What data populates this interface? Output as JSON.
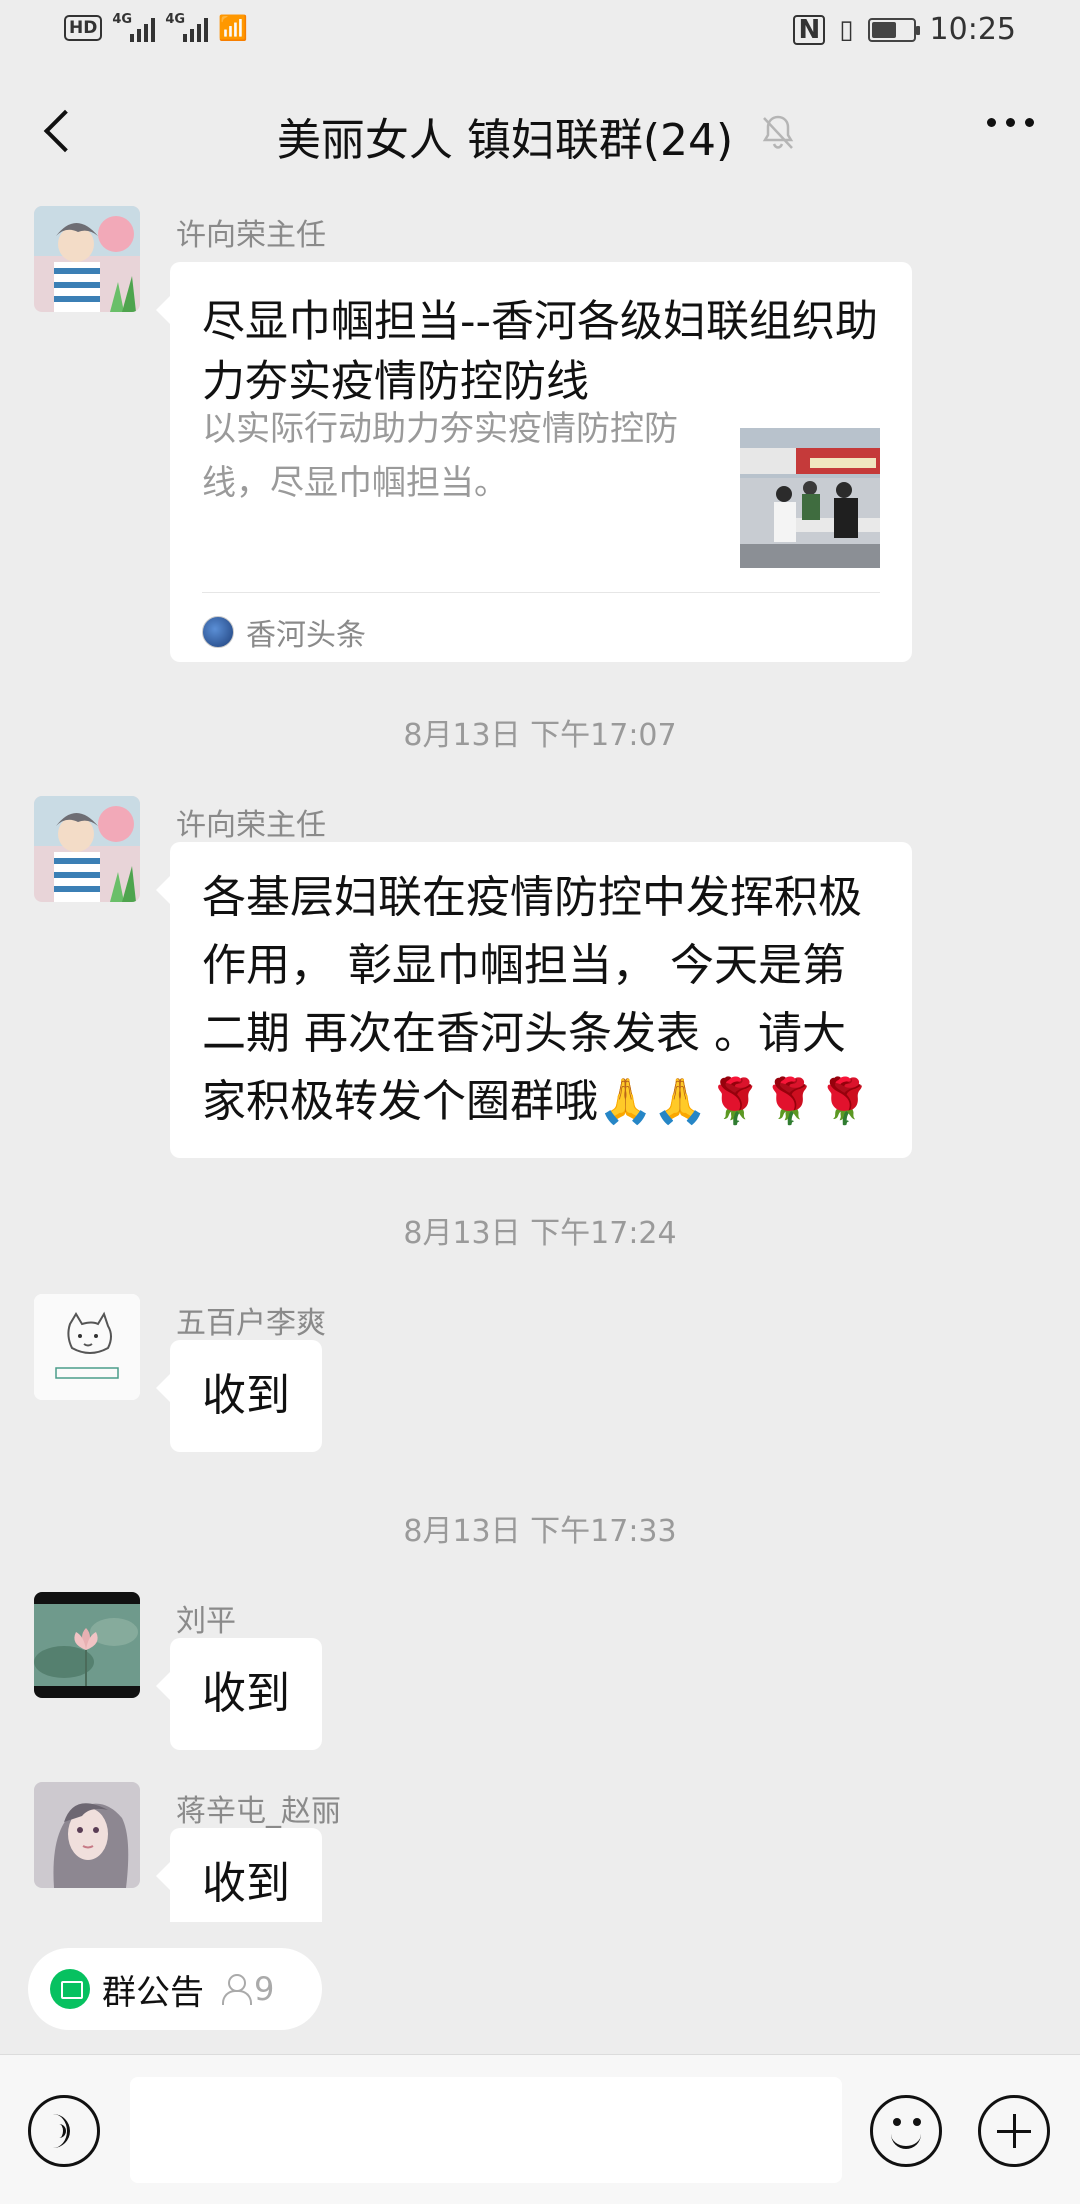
{
  "status_bar": {
    "hd": "HD",
    "network_1": "4G",
    "network_2": "4G",
    "time": "10:25",
    "battery_level": 0.6
  },
  "header": {
    "title": "美丽女人 镇妇联群(24)",
    "back_icon": "chevron-left-icon",
    "mute_icon": "bell-off-icon",
    "more_icon": "more-dots-icon"
  },
  "messages": [
    {
      "type": "link_card",
      "sender": "许向荣主任",
      "card_title": "尽显巾帼担当--香河各级妇联组织助力夯实疫情防控防线",
      "card_desc": "以实际行动助力夯实疫情防控防线，尽显巾帼担当。",
      "card_source": "香河头条"
    },
    {
      "type": "time",
      "text": "8月13日 下午17:07"
    },
    {
      "type": "text",
      "sender": "许向荣主任",
      "text": "各基层妇联在疫情防控中发挥积极作用， 彰显巾帼担当， 今天是第二期 再次在香河头条发表 。请大家积极转发个圈群哦🙏🙏🌹🌹🌹"
    },
    {
      "type": "time",
      "text": "8月13日 下午17:24"
    },
    {
      "type": "text",
      "sender": "五百户李爽",
      "text": "收到"
    },
    {
      "type": "time",
      "text": "8月13日 下午17:33"
    },
    {
      "type": "text",
      "sender": "刘平",
      "text": "收到"
    },
    {
      "type": "text",
      "sender": "蒋辛屯_赵丽",
      "text": "收到"
    }
  ],
  "footer": {
    "notice_label": "群公告",
    "notice_count": "9",
    "input_value": "",
    "voice_icon": "voice-icon",
    "emoji_icon": "emoji-icon",
    "plus_icon": "plus-icon"
  },
  "colors": {
    "background": "#ededed",
    "accent": "#07c160",
    "bubble": "#ffffff"
  }
}
